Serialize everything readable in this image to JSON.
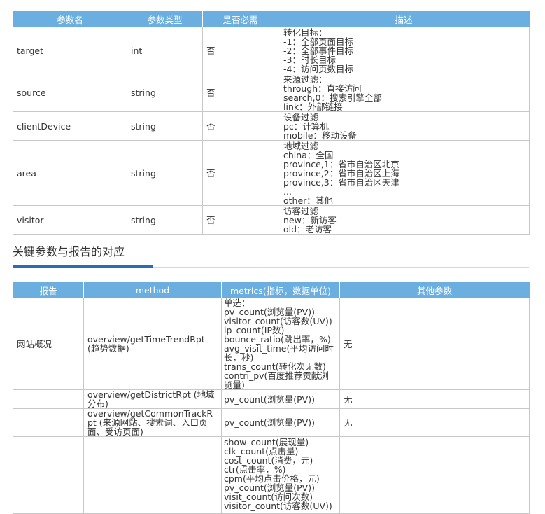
{
  "table1": {
    "headers": [
      "参数名",
      "参数类型",
      "是否必需",
      "描述"
    ],
    "rows": [
      {
        "name": "target",
        "type": "int",
        "required": "否",
        "desc": [
          "转化目标：",
          "-1：全部页面目标",
          "-2：全部事件目标",
          "-3：时长目标",
          "-4：访问页数目标"
        ]
      },
      {
        "name": "source",
        "type": "string",
        "required": "否",
        "desc": [
          "来源过滤：",
          "through：直接访问",
          "search,0：搜索引擎全部",
          "link：外部链接"
        ]
      },
      {
        "name": "clientDevice",
        "type": "string",
        "required": "否",
        "desc": [
          "设备过滤",
          "pc：计算机",
          "mobile：移动设备"
        ]
      },
      {
        "name": "area",
        "type": "string",
        "required": "否",
        "desc": [
          "地域过滤",
          "china：全国",
          "province,1：省市自治区北京",
          "province,2：省市自治区上海",
          "province,3：省市自治区天津",
          "...",
          "other：其他"
        ]
      },
      {
        "name": "visitor",
        "type": "string",
        "required": "否",
        "desc": [
          "访客过滤",
          "new：新访客",
          "old：老访客"
        ]
      }
    ]
  },
  "section": {
    "title": "关键参数与报告的对应"
  },
  "table2": {
    "headers": [
      "报告",
      "method",
      "metrics(指标，数据单位)",
      "其他参数"
    ],
    "rows": [
      {
        "report": "网站概况",
        "method": "overview/getTimeTrendRpt (趋势数据)",
        "metrics": [
          "单选：",
          "pv_count(浏览量(PV))",
          "visitor_count(访客数(UV))",
          "ip_count(IP数)",
          "bounce_ratio(跳出率，%)",
          "avg_visit_time(平均访问时长，秒)",
          "trans_count(转化次无数)",
          "contri_pv(百度推荐贡献浏览量)"
        ],
        "other": "无"
      },
      {
        "report": "",
        "method": "overview/getDistrictRpt (地域分布)",
        "metrics": [
          "pv_count(浏览量(PV))"
        ],
        "other": "无"
      },
      {
        "report": "",
        "method": "overview/getCommonTrackRpt (来源网站、搜索词、入口页面、受访页面)",
        "metrics": [
          "pv_count(浏览量(PV))"
        ],
        "other": "无"
      },
      {
        "report": "",
        "method": "",
        "metrics": [
          "show_count(展现量)",
          "clk_count(点击量)",
          "cost_count(消费，元)",
          "ctr(点击率，%)",
          "cpm(平均点击价格，元)",
          "pv_count(浏览量(PV))",
          "visit_count(访问次数)",
          "visitor_count(访客数(UV))"
        ],
        "other": ""
      }
    ]
  }
}
